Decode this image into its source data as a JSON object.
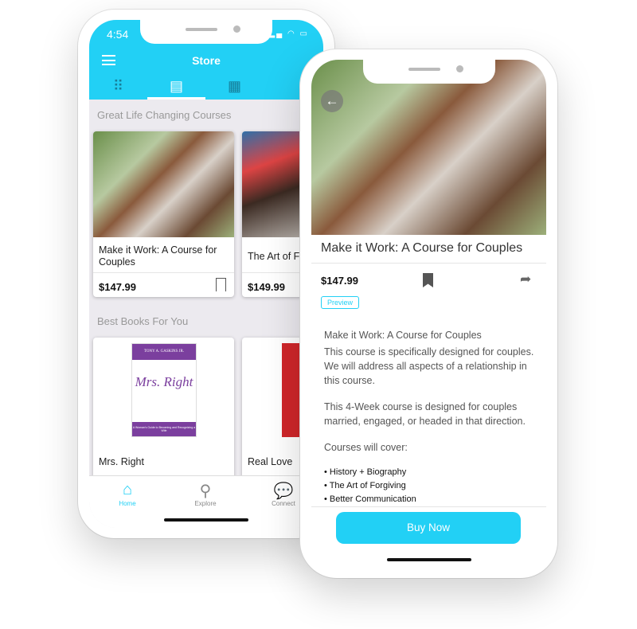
{
  "store_screen": {
    "status_time": "4:54",
    "title": "Store",
    "tabs": [
      {
        "icon": "grid-icon",
        "active": false
      },
      {
        "icon": "notebook-icon",
        "active": true
      },
      {
        "icon": "calendar-icon",
        "active": false
      },
      {
        "icon": "bookmark-icon",
        "active": false
      }
    ],
    "sections": [
      {
        "title": "Great Life Changing Courses",
        "items": [
          {
            "title": "Make it Work: A Course for Couples",
            "price": "$147.99"
          },
          {
            "title": "The Art of F",
            "price": "$149.99"
          }
        ]
      },
      {
        "title": "Best Books For You",
        "items": [
          {
            "title": "Mrs. Right",
            "cover_author": "TONY A. GASKINS JR.",
            "cover_title": "Mrs. Right",
            "cover_subtitle": "A Woman's Guide to Becoming and Recognizing a Wife"
          },
          {
            "title": "Real Love"
          }
        ]
      }
    ],
    "tabbar": [
      {
        "label": "Home",
        "icon": "home-icon",
        "active": true
      },
      {
        "label": "Explore",
        "icon": "search-icon",
        "active": false
      },
      {
        "label": "Connect",
        "icon": "chat-icon",
        "active": false
      }
    ]
  },
  "detail_screen": {
    "title": "Make it Work: A Course for Couples",
    "price": "$147.99",
    "preview_label": "Preview",
    "description_heading": "Make it Work: A Course for Couples",
    "paragraphs": [
      "This course is specifically designed for couples. We will address all aspects of a relationship in this course.",
      "This 4-Week course is designed for couples married, engaged, or headed in that direction.",
      "Courses will cover:"
    ],
    "bullets": [
      "• History + Biography",
      "• The Art of Forgiving",
      "• Better Communication"
    ],
    "buy_label": "Buy Now"
  },
  "colors": {
    "accent": "#22d0f5",
    "tab_inactive": "#167e9a"
  }
}
